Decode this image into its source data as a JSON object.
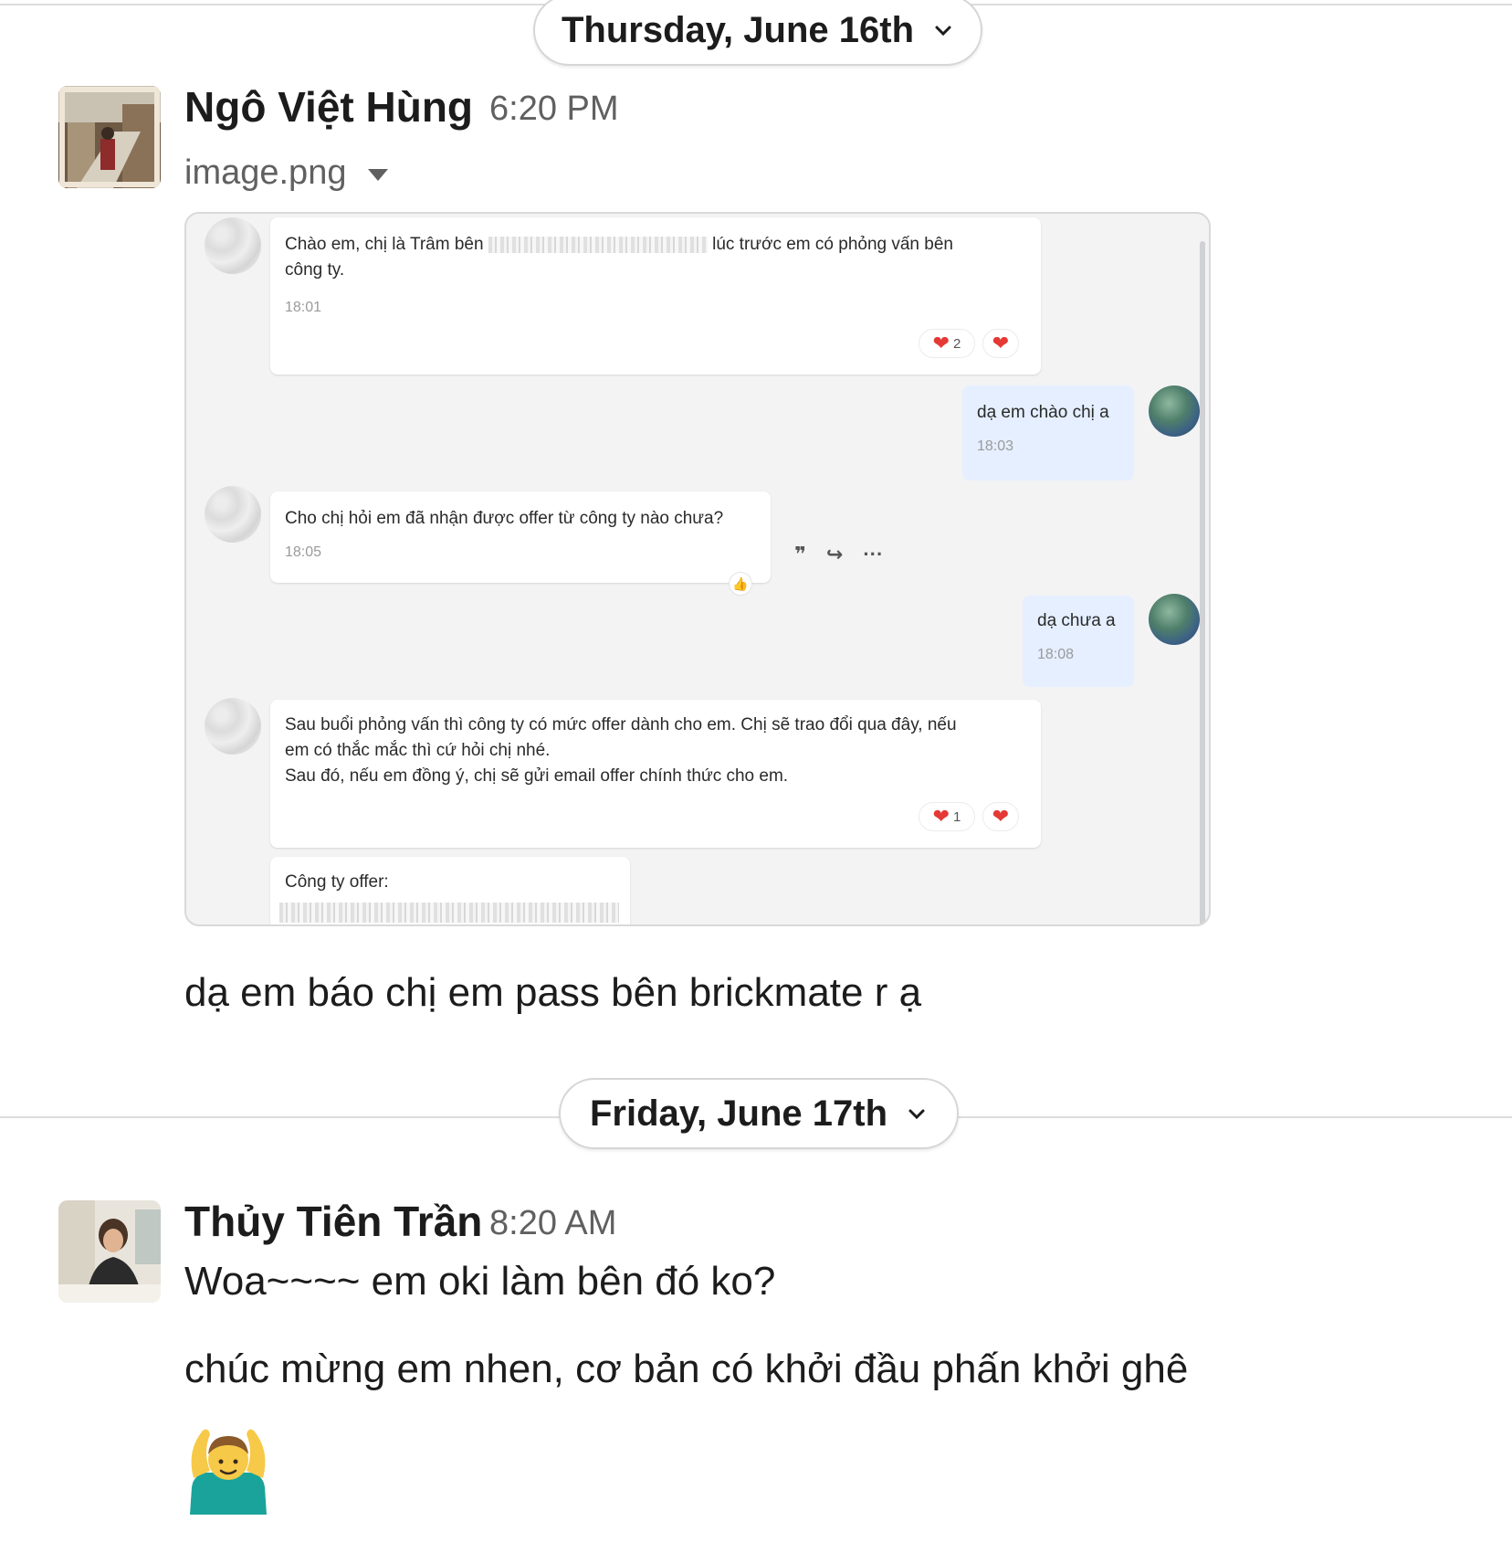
{
  "dividers": [
    {
      "label": "Thursday, June 16th"
    },
    {
      "label": "Friday, June 17th"
    }
  ],
  "messages": [
    {
      "sender": "Ngô Việt Hùng",
      "time": "6:20 PM",
      "attachment_name": "image.png",
      "text": "dạ em báo chị em pass bên brickmate r ạ"
    },
    {
      "sender": "Thủy Tiên Trần",
      "time": "8:20 AM",
      "lines": [
        "Woa~~~~ em oki làm bên đó ko?",
        "chúc mừng em nhen, cơ bản có khởi đầu phấn khởi ghê"
      ],
      "emoji": "person-gesturing-ok"
    }
  ],
  "attachment_chat": {
    "m1": {
      "line1_before": "Chào em, chị là Trâm bên ",
      "line1_after": " lúc trước em có phỏng vấn bên",
      "line2": "công ty.",
      "time": "18:01",
      "reaction_count": "2"
    },
    "m2": {
      "text": "dạ em chào chị a",
      "time": "18:03"
    },
    "m3": {
      "text": "Cho chị hỏi em đã nhận được offer từ công ty nào chưa?",
      "time": "18:05"
    },
    "m4": {
      "text": "dạ chưa a",
      "time": "18:08"
    },
    "m5": {
      "line1": "Sau buổi phỏng vấn thì công ty có mức offer dành cho em. Chị sẽ trao đổi qua đây, nếu",
      "line2": "em có thắc mắc thì cứ hỏi chị nhé.",
      "line3": "Sau đó, nếu em đồng ý, chị sẽ gửi email offer chính thức cho em.",
      "reaction_count": "1"
    },
    "m6": {
      "label": "Công ty offer:"
    }
  },
  "colors": {
    "reaction_heart": "#e53935",
    "my_bubble": "#e5efff",
    "chat_bg": "#f3f3f4"
  }
}
